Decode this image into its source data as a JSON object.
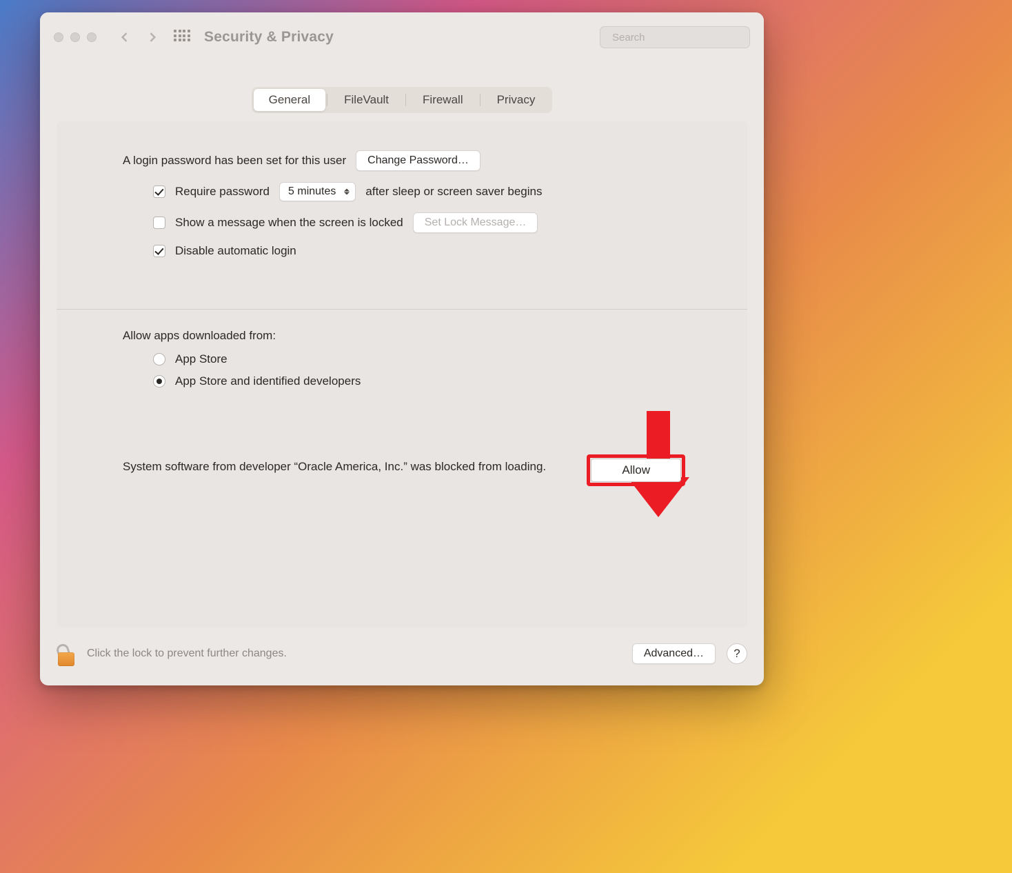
{
  "toolbar": {
    "title": "Security & Privacy",
    "search_placeholder": "Search"
  },
  "tabs": {
    "general": "General",
    "filevault": "FileVault",
    "firewall": "Firewall",
    "privacy": "Privacy",
    "active": "general"
  },
  "login": {
    "password_set": "A login password has been set for this user",
    "change_password": "Change Password…",
    "require_password_label": "Require password",
    "require_password_delay": "5 minutes",
    "require_password_suffix": "after sleep or screen saver begins",
    "show_message": "Show a message when the screen is locked",
    "set_lock_message": "Set Lock Message…",
    "disable_auto_login": "Disable automatic login",
    "require_password_checked": true,
    "show_message_checked": false,
    "disable_auto_login_checked": true
  },
  "allow_apps": {
    "heading": "Allow apps downloaded from:",
    "opt_app_store": "App Store",
    "opt_identified": "App Store and identified developers",
    "selected": "identified"
  },
  "blocked": {
    "message": "System software from developer “Oracle America, Inc.” was blocked from loading.",
    "allow": "Allow"
  },
  "footer": {
    "lock_hint": "Click the lock to prevent further changes.",
    "advanced": "Advanced…",
    "help": "?"
  }
}
